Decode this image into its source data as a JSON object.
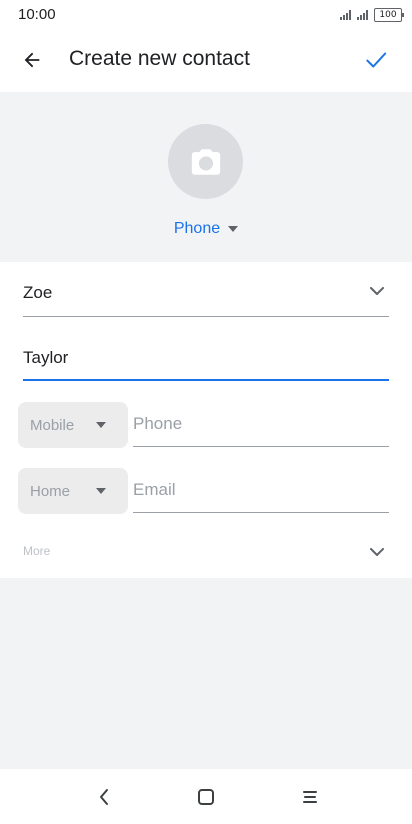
{
  "status_bar": {
    "time": "10:00",
    "battery": "100"
  },
  "app_bar": {
    "title": "Create new contact"
  },
  "photo": {
    "account_label": "Phone"
  },
  "form": {
    "first_name": "Zoe",
    "last_name": "Taylor",
    "phone": {
      "type_label": "Mobile",
      "placeholder": "Phone"
    },
    "email": {
      "type_label": "Home",
      "placeholder": "Email"
    },
    "more_label": "More"
  },
  "colors": {
    "accent": "#1a73e8",
    "section_bg": "#f1f3f4",
    "avatar_bg": "#dadce0"
  },
  "icons": {
    "back": "arrow-left-icon",
    "save": "checkmark-icon",
    "camera": "camera-icon",
    "dropdown": "caret-down-icon",
    "expand": "chevron-down-icon",
    "nav_back": "chevron-left-icon",
    "nav_home": "square-icon",
    "nav_menu": "menu-icon"
  }
}
